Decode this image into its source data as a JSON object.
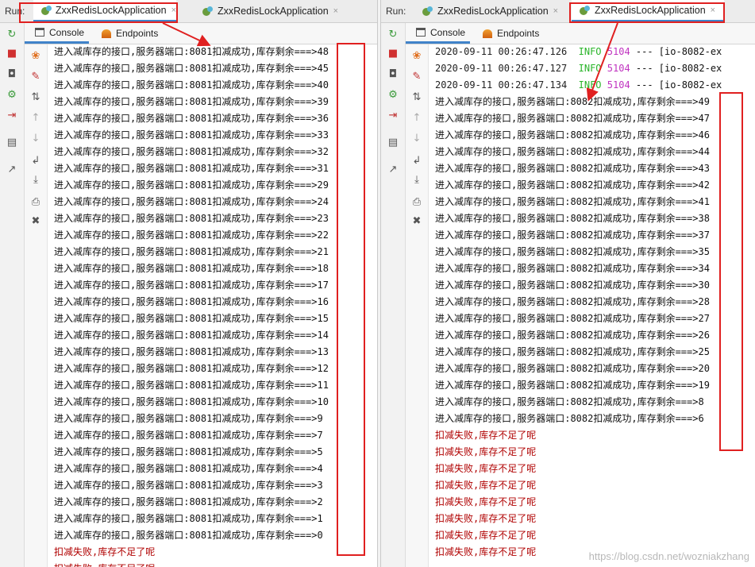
{
  "left": {
    "run_label": "Run:",
    "tabs": [
      {
        "label": "ZxxRedisLockApplication",
        "close": "×",
        "active": true
      },
      {
        "label": "ZxxRedisLockApplication",
        "close": "×",
        "active": false
      }
    ],
    "console_tab": "Console",
    "endpoints_tab": "Endpoints",
    "log_prefix": "进入减库存的接口,服务器端口:8081扣减成功,库存剩余===>",
    "values": [
      "48",
      "45",
      "40",
      "39",
      "36",
      "33",
      "32",
      "31",
      "29",
      "24",
      "23",
      "22",
      "21",
      "18",
      "17",
      "16",
      "15",
      "14",
      "13",
      "12",
      "11",
      "10",
      "9",
      "7",
      "5",
      "4",
      "3",
      "2",
      "1",
      "0"
    ],
    "error_lines": [
      "扣减失败,库存不足了呢",
      "扣减失败,库存不足了呢"
    ]
  },
  "right": {
    "run_label": "Run:",
    "tabs": [
      {
        "label": "ZxxRedisLockApplication",
        "close": "×",
        "active": false
      },
      {
        "label": "ZxxRedisLockApplication",
        "close": "×",
        "active": true
      }
    ],
    "console_tab": "Console",
    "endpoints_tab": "Endpoints",
    "log_lines": [
      {
        "time": "2020-09-11 00:26:47.126",
        "level": "INFO",
        "pid": "5104",
        "rest": "--- [io-8082-ex"
      },
      {
        "time": "2020-09-11 00:26:47.127",
        "level": "INFO",
        "pid": "5104",
        "rest": "--- [io-8082-ex"
      },
      {
        "time": "2020-09-11 00:26:47.134",
        "level": "INFO",
        "pid": "5104",
        "rest": "--- [io-8082-ex"
      }
    ],
    "log_prefix": "进入减库存的接口,服务器端口:8082扣减成功,库存剩余===>",
    "values": [
      "49",
      "47",
      "46",
      "44",
      "43",
      "42",
      "41",
      "38",
      "37",
      "35",
      "34",
      "30",
      "28",
      "27",
      "26",
      "25",
      "20",
      "19",
      "8",
      "6"
    ],
    "error_lines": [
      "扣减失败,库存不足了呢",
      "扣减失败,库存不足了呢",
      "扣减失败,库存不足了呢",
      "扣减失败,库存不足了呢",
      "扣减失败,库存不足了呢",
      "扣减失败,库存不足了呢",
      "扣减失败,库存不足了呢",
      "扣减失败,库存不足了呢"
    ]
  },
  "watermark": "https://blog.csdn.net/wozniakzhang",
  "icons": [
    "rerun-icon",
    "stop-icon",
    "camera-icon",
    "debug-icon",
    "exit-icon",
    "layout-icon",
    "pin-icon",
    "pause-debug-icon",
    "clear-icon",
    "sort-icon",
    "up-icon",
    "down-icon",
    "wrap-icon",
    "scroll-end-icon",
    "print-icon",
    "trash-icon"
  ],
  "colors": {
    "highlight": "#e02020",
    "accent": "#4083c9",
    "error_text": "#b00000",
    "info": "#2bb52b",
    "pid": "#c033c0"
  }
}
